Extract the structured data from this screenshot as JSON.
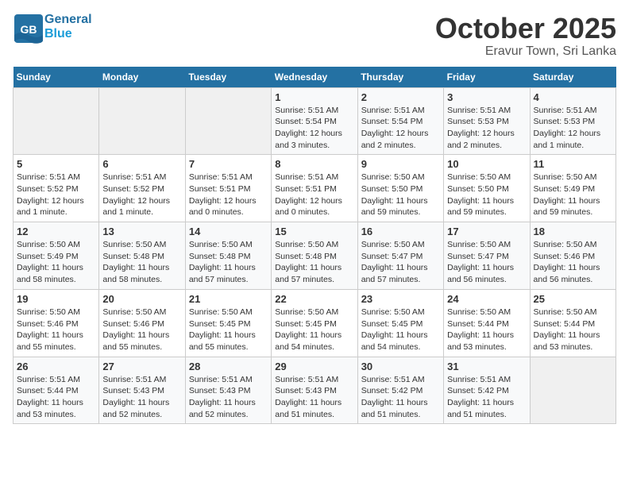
{
  "header": {
    "logo_text_general": "General",
    "logo_text_blue": "Blue",
    "month_title": "October 2025",
    "location": "Eravur Town, Sri Lanka"
  },
  "days_of_week": [
    "Sunday",
    "Monday",
    "Tuesday",
    "Wednesday",
    "Thursday",
    "Friday",
    "Saturday"
  ],
  "weeks": [
    [
      {
        "day": "",
        "info": ""
      },
      {
        "day": "",
        "info": ""
      },
      {
        "day": "",
        "info": ""
      },
      {
        "day": "1",
        "info": "Sunrise: 5:51 AM\nSunset: 5:54 PM\nDaylight: 12 hours\nand 3 minutes."
      },
      {
        "day": "2",
        "info": "Sunrise: 5:51 AM\nSunset: 5:54 PM\nDaylight: 12 hours\nand 2 minutes."
      },
      {
        "day": "3",
        "info": "Sunrise: 5:51 AM\nSunset: 5:53 PM\nDaylight: 12 hours\nand 2 minutes."
      },
      {
        "day": "4",
        "info": "Sunrise: 5:51 AM\nSunset: 5:53 PM\nDaylight: 12 hours\nand 1 minute."
      }
    ],
    [
      {
        "day": "5",
        "info": "Sunrise: 5:51 AM\nSunset: 5:52 PM\nDaylight: 12 hours\nand 1 minute."
      },
      {
        "day": "6",
        "info": "Sunrise: 5:51 AM\nSunset: 5:52 PM\nDaylight: 12 hours\nand 1 minute."
      },
      {
        "day": "7",
        "info": "Sunrise: 5:51 AM\nSunset: 5:51 PM\nDaylight: 12 hours\nand 0 minutes."
      },
      {
        "day": "8",
        "info": "Sunrise: 5:51 AM\nSunset: 5:51 PM\nDaylight: 12 hours\nand 0 minutes."
      },
      {
        "day": "9",
        "info": "Sunrise: 5:50 AM\nSunset: 5:50 PM\nDaylight: 11 hours\nand 59 minutes."
      },
      {
        "day": "10",
        "info": "Sunrise: 5:50 AM\nSunset: 5:50 PM\nDaylight: 11 hours\nand 59 minutes."
      },
      {
        "day": "11",
        "info": "Sunrise: 5:50 AM\nSunset: 5:49 PM\nDaylight: 11 hours\nand 59 minutes."
      }
    ],
    [
      {
        "day": "12",
        "info": "Sunrise: 5:50 AM\nSunset: 5:49 PM\nDaylight: 11 hours\nand 58 minutes."
      },
      {
        "day": "13",
        "info": "Sunrise: 5:50 AM\nSunset: 5:48 PM\nDaylight: 11 hours\nand 58 minutes."
      },
      {
        "day": "14",
        "info": "Sunrise: 5:50 AM\nSunset: 5:48 PM\nDaylight: 11 hours\nand 57 minutes."
      },
      {
        "day": "15",
        "info": "Sunrise: 5:50 AM\nSunset: 5:48 PM\nDaylight: 11 hours\nand 57 minutes."
      },
      {
        "day": "16",
        "info": "Sunrise: 5:50 AM\nSunset: 5:47 PM\nDaylight: 11 hours\nand 57 minutes."
      },
      {
        "day": "17",
        "info": "Sunrise: 5:50 AM\nSunset: 5:47 PM\nDaylight: 11 hours\nand 56 minutes."
      },
      {
        "day": "18",
        "info": "Sunrise: 5:50 AM\nSunset: 5:46 PM\nDaylight: 11 hours\nand 56 minutes."
      }
    ],
    [
      {
        "day": "19",
        "info": "Sunrise: 5:50 AM\nSunset: 5:46 PM\nDaylight: 11 hours\nand 55 minutes."
      },
      {
        "day": "20",
        "info": "Sunrise: 5:50 AM\nSunset: 5:46 PM\nDaylight: 11 hours\nand 55 minutes."
      },
      {
        "day": "21",
        "info": "Sunrise: 5:50 AM\nSunset: 5:45 PM\nDaylight: 11 hours\nand 55 minutes."
      },
      {
        "day": "22",
        "info": "Sunrise: 5:50 AM\nSunset: 5:45 PM\nDaylight: 11 hours\nand 54 minutes."
      },
      {
        "day": "23",
        "info": "Sunrise: 5:50 AM\nSunset: 5:45 PM\nDaylight: 11 hours\nand 54 minutes."
      },
      {
        "day": "24",
        "info": "Sunrise: 5:50 AM\nSunset: 5:44 PM\nDaylight: 11 hours\nand 53 minutes."
      },
      {
        "day": "25",
        "info": "Sunrise: 5:50 AM\nSunset: 5:44 PM\nDaylight: 11 hours\nand 53 minutes."
      }
    ],
    [
      {
        "day": "26",
        "info": "Sunrise: 5:51 AM\nSunset: 5:44 PM\nDaylight: 11 hours\nand 53 minutes."
      },
      {
        "day": "27",
        "info": "Sunrise: 5:51 AM\nSunset: 5:43 PM\nDaylight: 11 hours\nand 52 minutes."
      },
      {
        "day": "28",
        "info": "Sunrise: 5:51 AM\nSunset: 5:43 PM\nDaylight: 11 hours\nand 52 minutes."
      },
      {
        "day": "29",
        "info": "Sunrise: 5:51 AM\nSunset: 5:43 PM\nDaylight: 11 hours\nand 51 minutes."
      },
      {
        "day": "30",
        "info": "Sunrise: 5:51 AM\nSunset: 5:42 PM\nDaylight: 11 hours\nand 51 minutes."
      },
      {
        "day": "31",
        "info": "Sunrise: 5:51 AM\nSunset: 5:42 PM\nDaylight: 11 hours\nand 51 minutes."
      },
      {
        "day": "",
        "info": ""
      }
    ]
  ]
}
